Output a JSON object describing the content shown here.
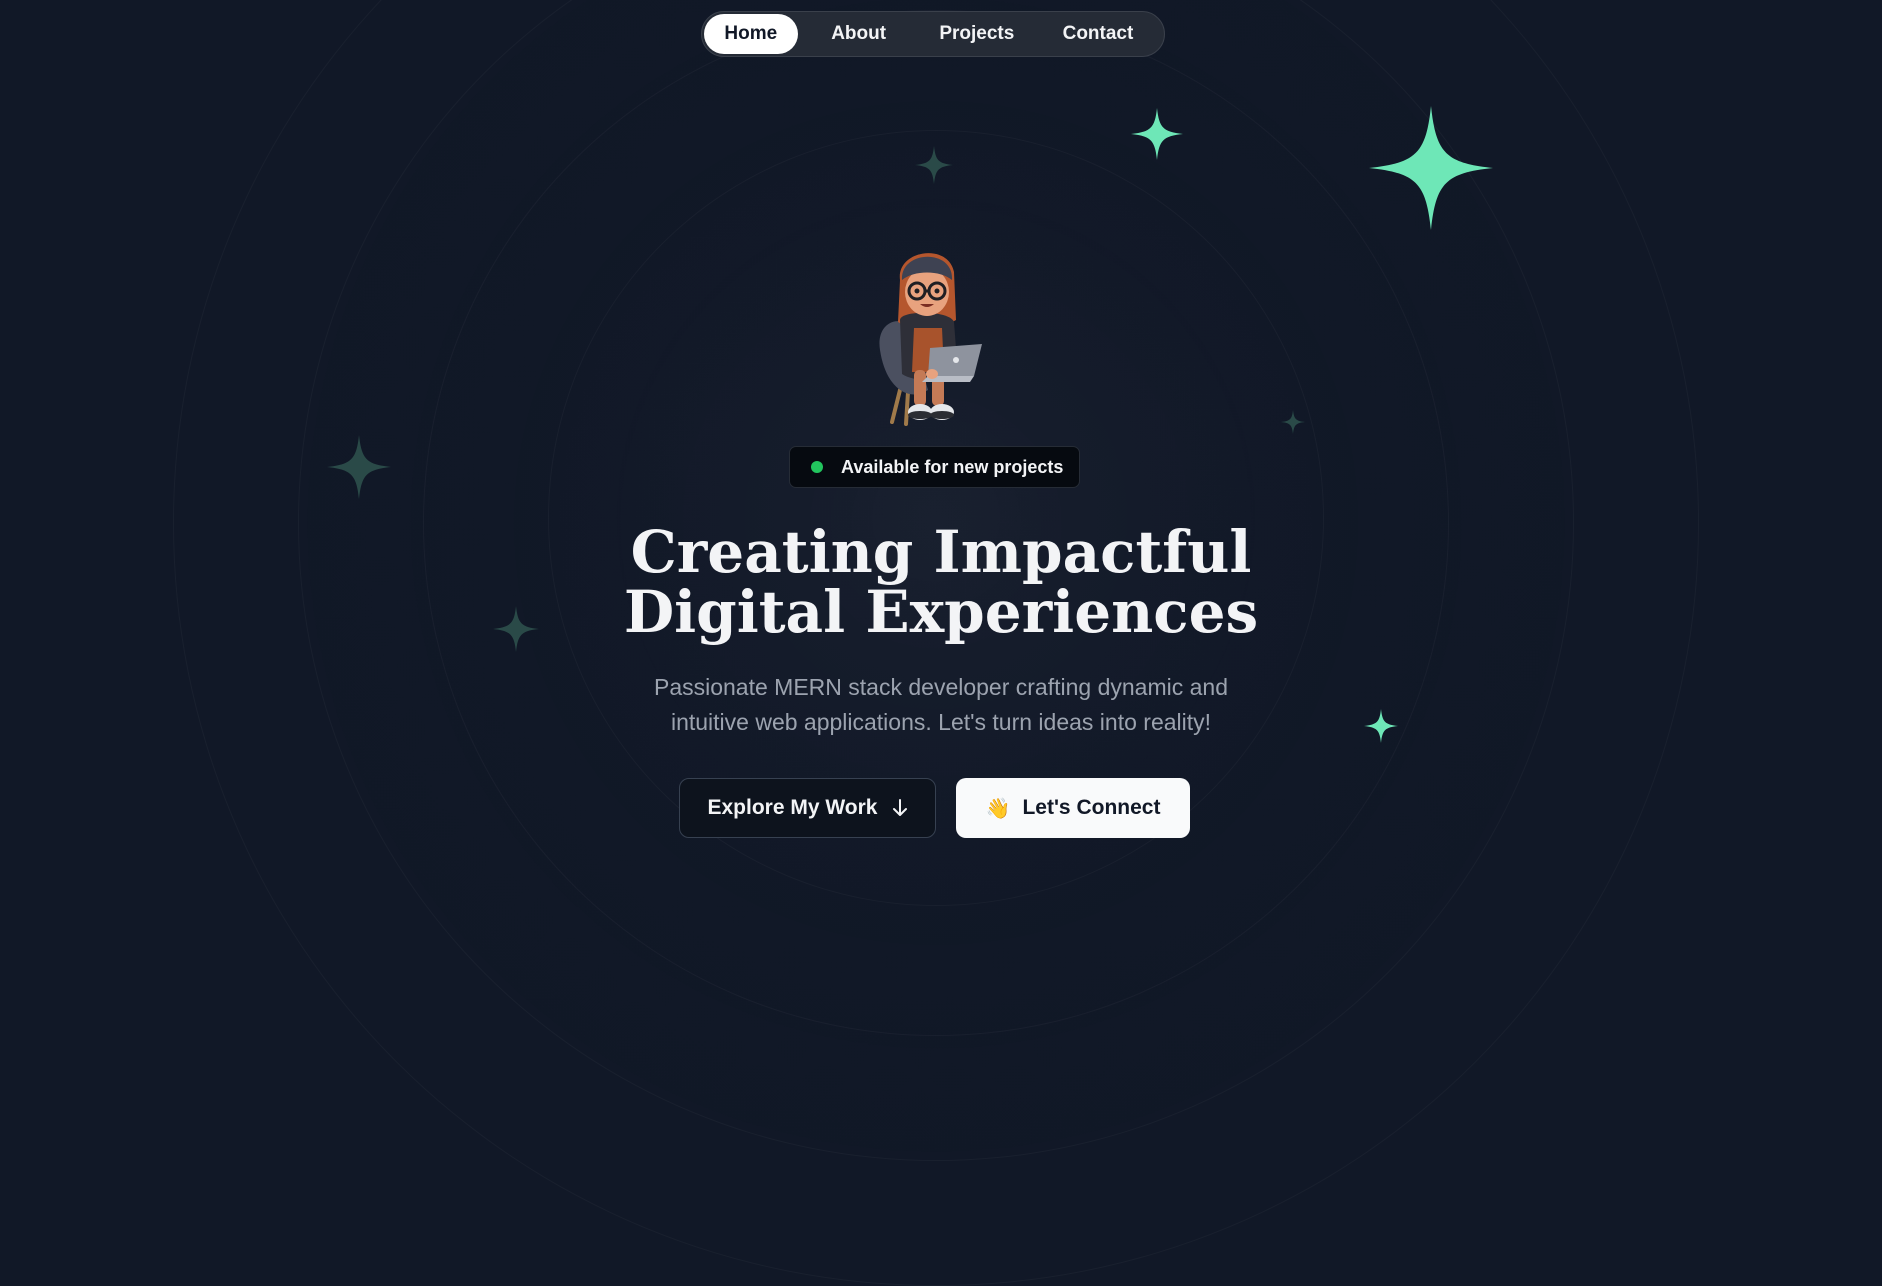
{
  "nav": {
    "items": [
      {
        "label": "Home",
        "active": true
      },
      {
        "label": "About",
        "active": false
      },
      {
        "label": "Projects",
        "active": false
      },
      {
        "label": "Contact",
        "active": false
      }
    ]
  },
  "hero": {
    "status_badge": "Available for new projects",
    "headline_line1": "Creating Impactful",
    "headline_line2": "Digital Experiences",
    "subtitle_line1": "Passionate MERN stack developer crafting dynamic and",
    "subtitle_line2": "intuitive web applications. Let's turn ideas into reality!",
    "explore_button": "Explore My Work",
    "connect_button": "Let's Connect",
    "connect_emoji": "👋"
  },
  "icons": {
    "avatar": "developer-with-laptop-avatar",
    "sparkle": "four-point-star-icon",
    "arrow": "arrow-down-icon"
  },
  "colors": {
    "background": "#111827",
    "accent_green": "#6ee7b7",
    "status_green": "#22c55e",
    "sparkle_dim": "#2a4a48"
  }
}
